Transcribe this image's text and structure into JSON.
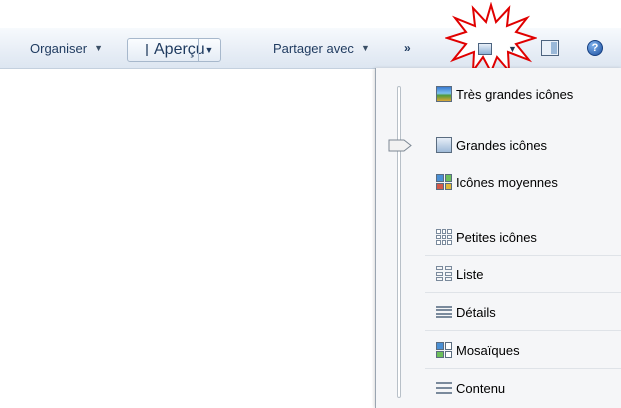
{
  "toolbar": {
    "organise": "Organiser",
    "apercu": "Aperçu",
    "share": "Partager avec",
    "more": "»"
  },
  "view_menu": {
    "items": [
      "Très grandes icônes",
      "Grandes icônes",
      "Icônes moyennes",
      "Petites icônes",
      "Liste",
      "Détails",
      "Mosaïques",
      "Contenu"
    ]
  },
  "colors": {
    "highlight_star": "#e00000",
    "toolbar_text": "#1e3a5f",
    "menu_bg": "#f5f6f8"
  },
  "icons": {
    "views_button": "views-icon",
    "preview_pane": "preview-pane-icon",
    "help": "help-icon"
  }
}
